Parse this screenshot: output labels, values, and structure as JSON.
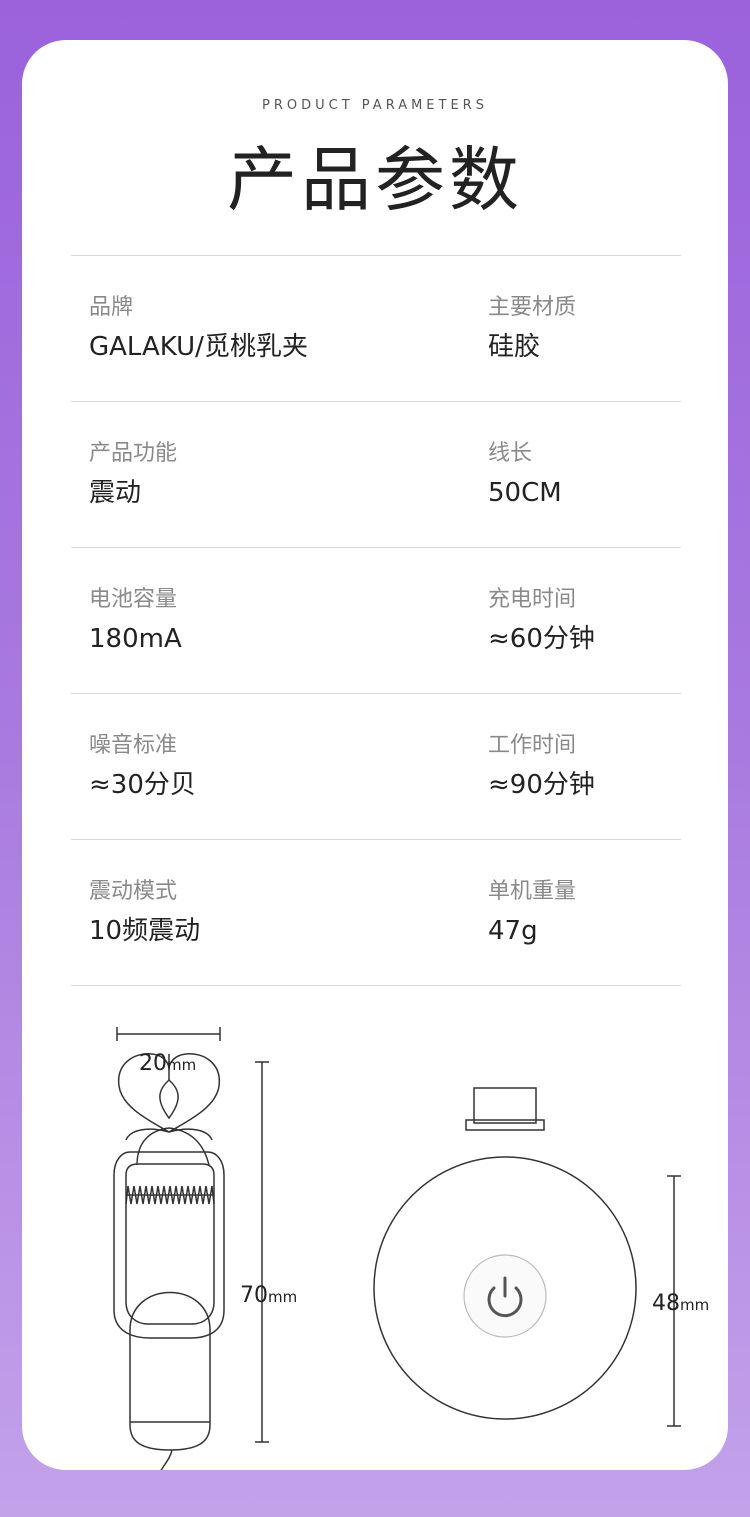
{
  "header": {
    "subtitle": "PRODUCT PARAMETERS",
    "title": "产品参数"
  },
  "params": [
    {
      "left": {
        "label": "品牌",
        "value": "GALAKU/觅桃乳夹"
      },
      "right": {
        "label": "主要材质",
        "value": "硅胶"
      }
    },
    {
      "left": {
        "label": "产品功能",
        "value": "震动"
      },
      "right": {
        "label": "线长",
        "value": "50CM"
      }
    },
    {
      "left": {
        "label": "电池容量",
        "value": "180mA"
      },
      "right": {
        "label": "充电时间",
        "value": "≈60分钟"
      }
    },
    {
      "left": {
        "label": "噪音标准",
        "value": "≈30分贝"
      },
      "right": {
        "label": "工作时间",
        "value": "≈90分钟"
      }
    },
    {
      "left": {
        "label": "震动模式",
        "value": "10频震动"
      },
      "right": {
        "label": "单机重量",
        "value": "47g"
      }
    }
  ],
  "dimensions": {
    "clip_width": {
      "value": "20",
      "unit": "mm"
    },
    "clip_height": {
      "value": "70",
      "unit": "mm"
    },
    "controller_diameter": {
      "value": "48",
      "unit": "mm"
    }
  },
  "icons": {
    "power": "power-icon"
  },
  "colors": {
    "background_top": "#9b62dc",
    "background_bottom": "#c4a2ea",
    "card": "#ffffff"
  }
}
